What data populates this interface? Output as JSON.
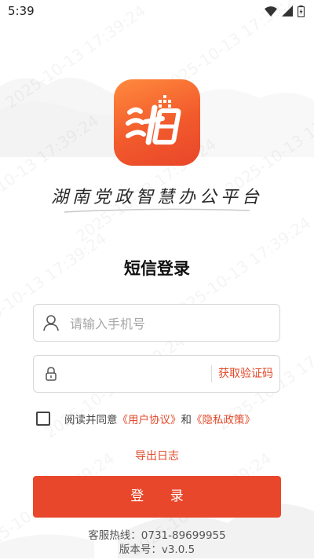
{
  "status_bar": {
    "time": "5:39"
  },
  "watermark": {
    "text": "2025-10-13 17:39:24"
  },
  "app": {
    "name": "湖南党政智慧办公平台"
  },
  "login": {
    "title": "短信登录",
    "phone_placeholder": "请输入手机号",
    "code_value": "",
    "get_code_label": "获取验证码",
    "agree_prefix": "阅读并同意",
    "user_agreement": "《用户协议》",
    "and_text": "和",
    "privacy_policy": "《隐私政策》",
    "agree_checked": false,
    "export_log": "导出日志",
    "login_button": "登 录"
  },
  "footer": {
    "hotline": "客服热线：0731-89699955",
    "version": "版本号：v3.0.5"
  },
  "colors": {
    "accent": "#e8472b",
    "logo_top": "#ff8a3d",
    "logo_bottom": "#e8462a"
  }
}
